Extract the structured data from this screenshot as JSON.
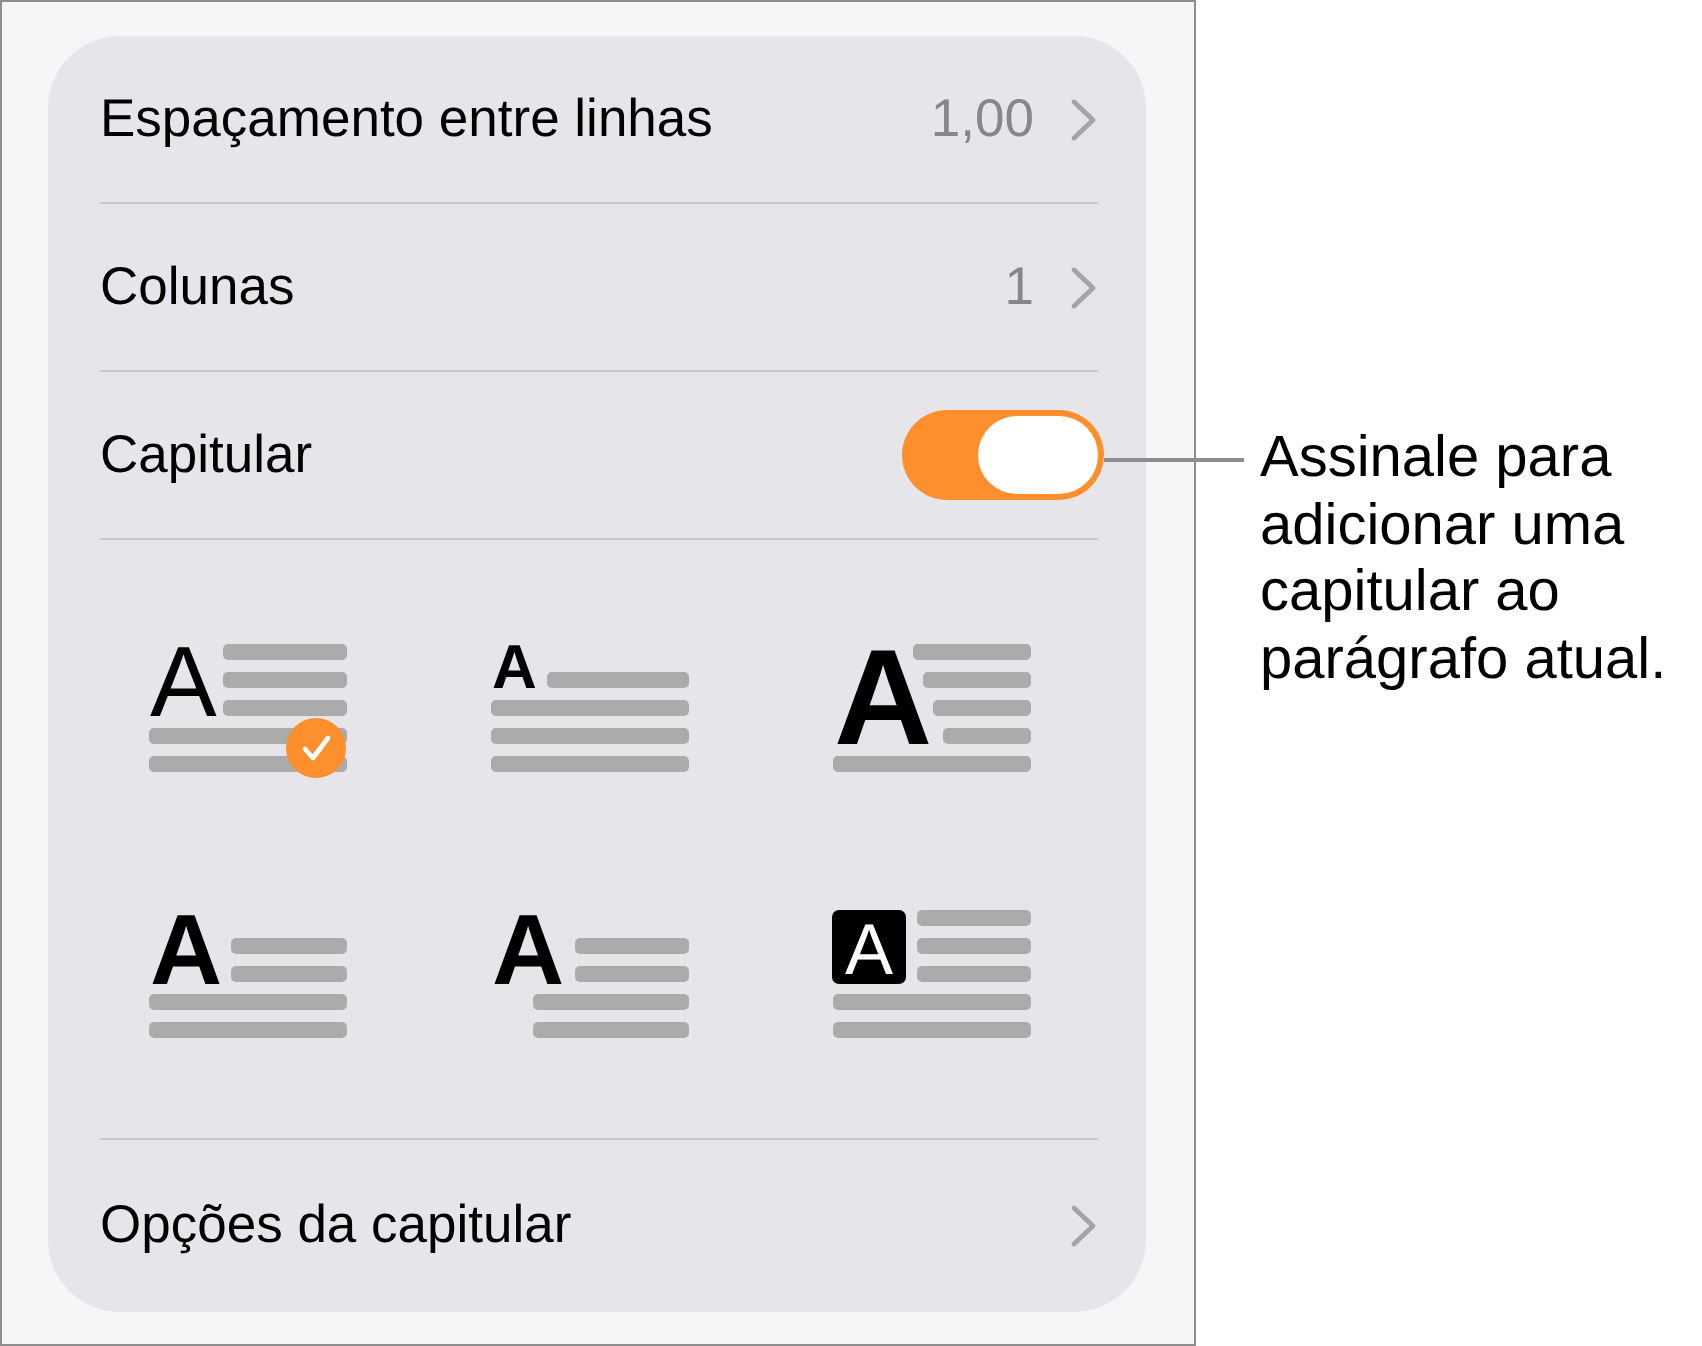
{
  "settings_rows": [
    {
      "kind": "value",
      "label": "Espaçamento entre linhas",
      "value": "1,00"
    },
    {
      "kind": "value",
      "label": "Colunas",
      "value": "1"
    },
    {
      "kind": "toggle",
      "label": "Capitular",
      "on": true
    }
  ],
  "drop_cap_styles": [
    {
      "kind": "thin",
      "letter": "A",
      "selected": true
    },
    {
      "kind": "raised",
      "letter": "A",
      "selected": false
    },
    {
      "kind": "large",
      "letter": "A",
      "selected": false
    },
    {
      "kind": "bold",
      "letter": "A",
      "selected": false
    },
    {
      "kind": "hanging",
      "letter": "A",
      "selected": false
    },
    {
      "kind": "boxed",
      "letter": "A",
      "selected": false
    }
  ],
  "options_row": {
    "label": "Opções da capitular"
  },
  "callout": {
    "text": "Assinale para adicionar uma capitular ao parágrafo atual."
  }
}
